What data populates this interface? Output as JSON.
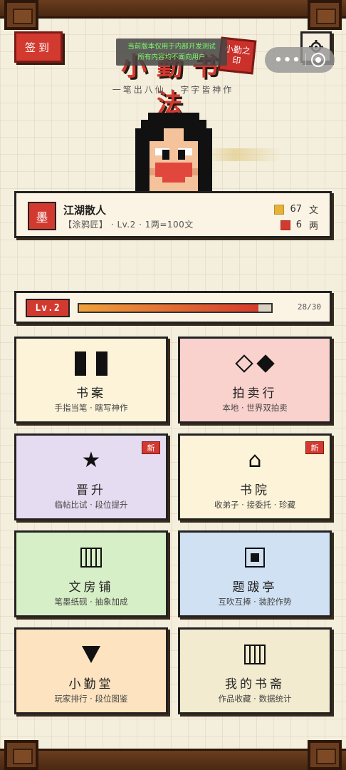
{
  "header": {
    "checkin_label": "签到",
    "settings_icon": "gear-icon",
    "title": "小勤书法",
    "seal_text": "小勤之印",
    "notice_line1": "当前版本仅用于内部开发测试",
    "notice_line2": "所有内容均不面向用户",
    "subtitle": "一笔出八仙 · 字字皆神作"
  },
  "capsule": {
    "more_icon": "more-dots-icon",
    "close_icon": "target-icon"
  },
  "player": {
    "icon_text": "墨",
    "name": "江湖散人",
    "meta": "【涂鸦匠】 · Lv.2 · 1两=100文",
    "gold_value": "67",
    "gold_unit": "文",
    "silver_value": "6",
    "silver_unit": "两",
    "gold_color": "#e8b23a",
    "silver_color": "#d23a30"
  },
  "level": {
    "badge": "Lv.2",
    "progress_text": "28/30",
    "progress_fraction": 0.933
  },
  "menu": [
    {
      "label": "书案",
      "sub": "手指当笔 · 瞎写神作",
      "icon": "bars-icon",
      "badge": ""
    },
    {
      "label": "拍卖行",
      "sub": "本地 · 世界双拍卖",
      "icon": "diamonds-icon",
      "badge": ""
    },
    {
      "label": "晋升",
      "sub": "临帖比试 · 段位提升",
      "icon": "star-icon",
      "badge": "新"
    },
    {
      "label": "书院",
      "sub": "收弟子 · 接委托 · 珍藏",
      "icon": "house-icon",
      "badge": "新"
    },
    {
      "label": "文房铺",
      "sub": "笔墨纸砚 · 抽象加成",
      "icon": "grid-icon",
      "badge": ""
    },
    {
      "label": "题跋亭",
      "sub": "互吹互捧 · 装腔作势",
      "icon": "square-icon",
      "badge": ""
    },
    {
      "label": "小勤堂",
      "sub": "玩家排行 · 段位图鉴",
      "icon": "triangle-icon",
      "badge": ""
    },
    {
      "label": "我的书斋",
      "sub": "作品收藏 · 数据统计",
      "icon": "grid-icon",
      "badge": ""
    }
  ],
  "colors": {
    "accent_red": "#d23a30",
    "paper": "#f4eedd",
    "wood": "#6a3d1f"
  }
}
